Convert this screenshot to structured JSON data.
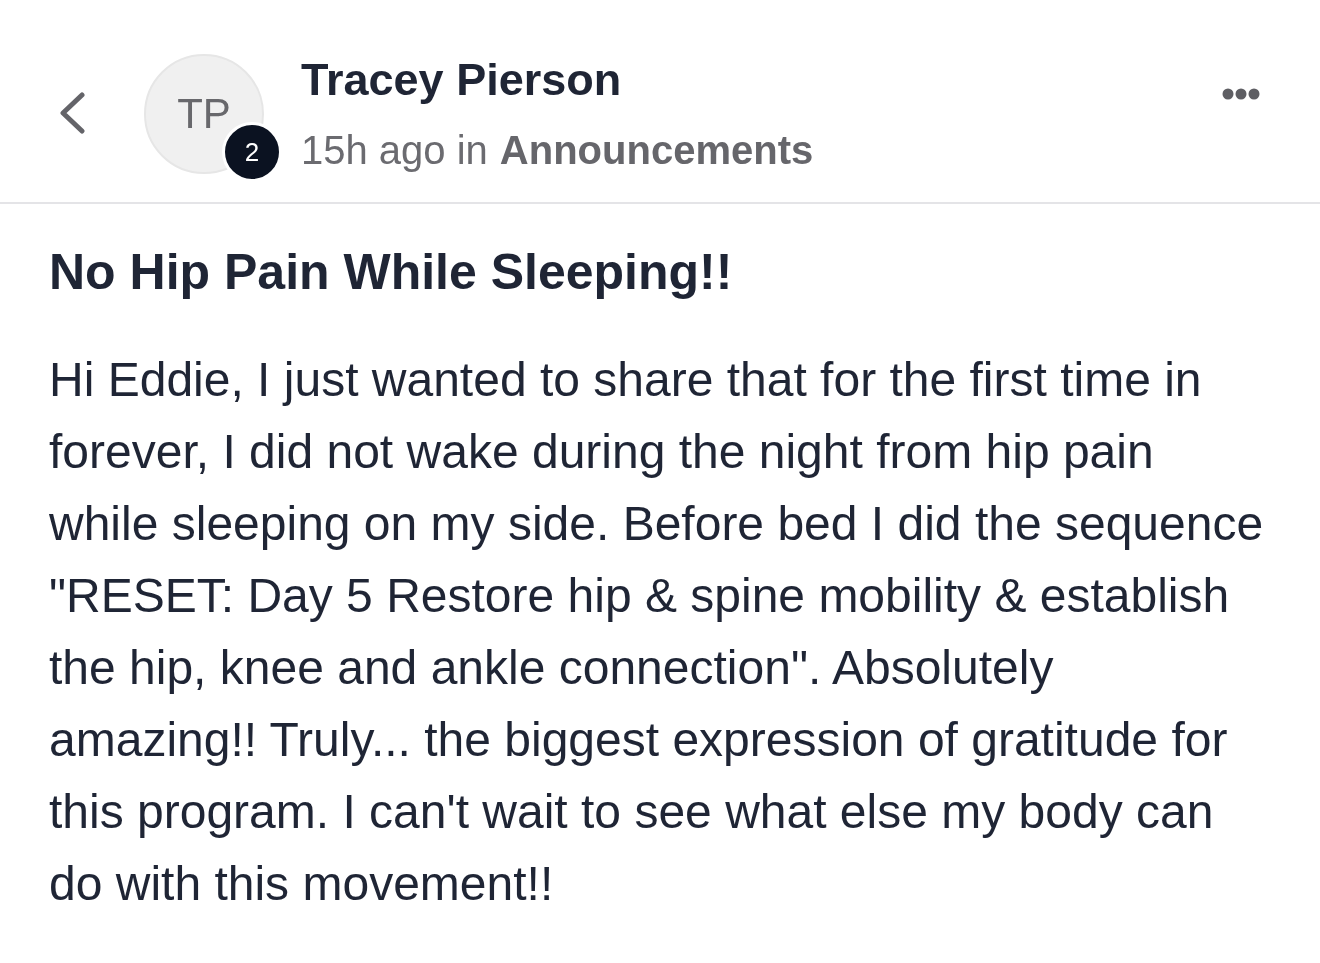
{
  "author": {
    "initials": "TP",
    "level_badge": "2",
    "name": "Tracey Pierson"
  },
  "meta": {
    "prefix": "15h ago in",
    "category": "Announcements"
  },
  "post": {
    "title": "No Hip Pain While Sleeping!!",
    "body": "Hi Eddie, I just wanted to share that for the first time in forever, I did not wake during the night from hip pain while sleeping on my side. Before bed I did the sequence \"RESET: Day 5 Restore hip & spine mobility & establish the hip, knee and ankle connection\". Absolutely amazing!! Truly... the biggest expression of gratitude for this program. I can't wait to see what else my body can do with this movement!!"
  }
}
